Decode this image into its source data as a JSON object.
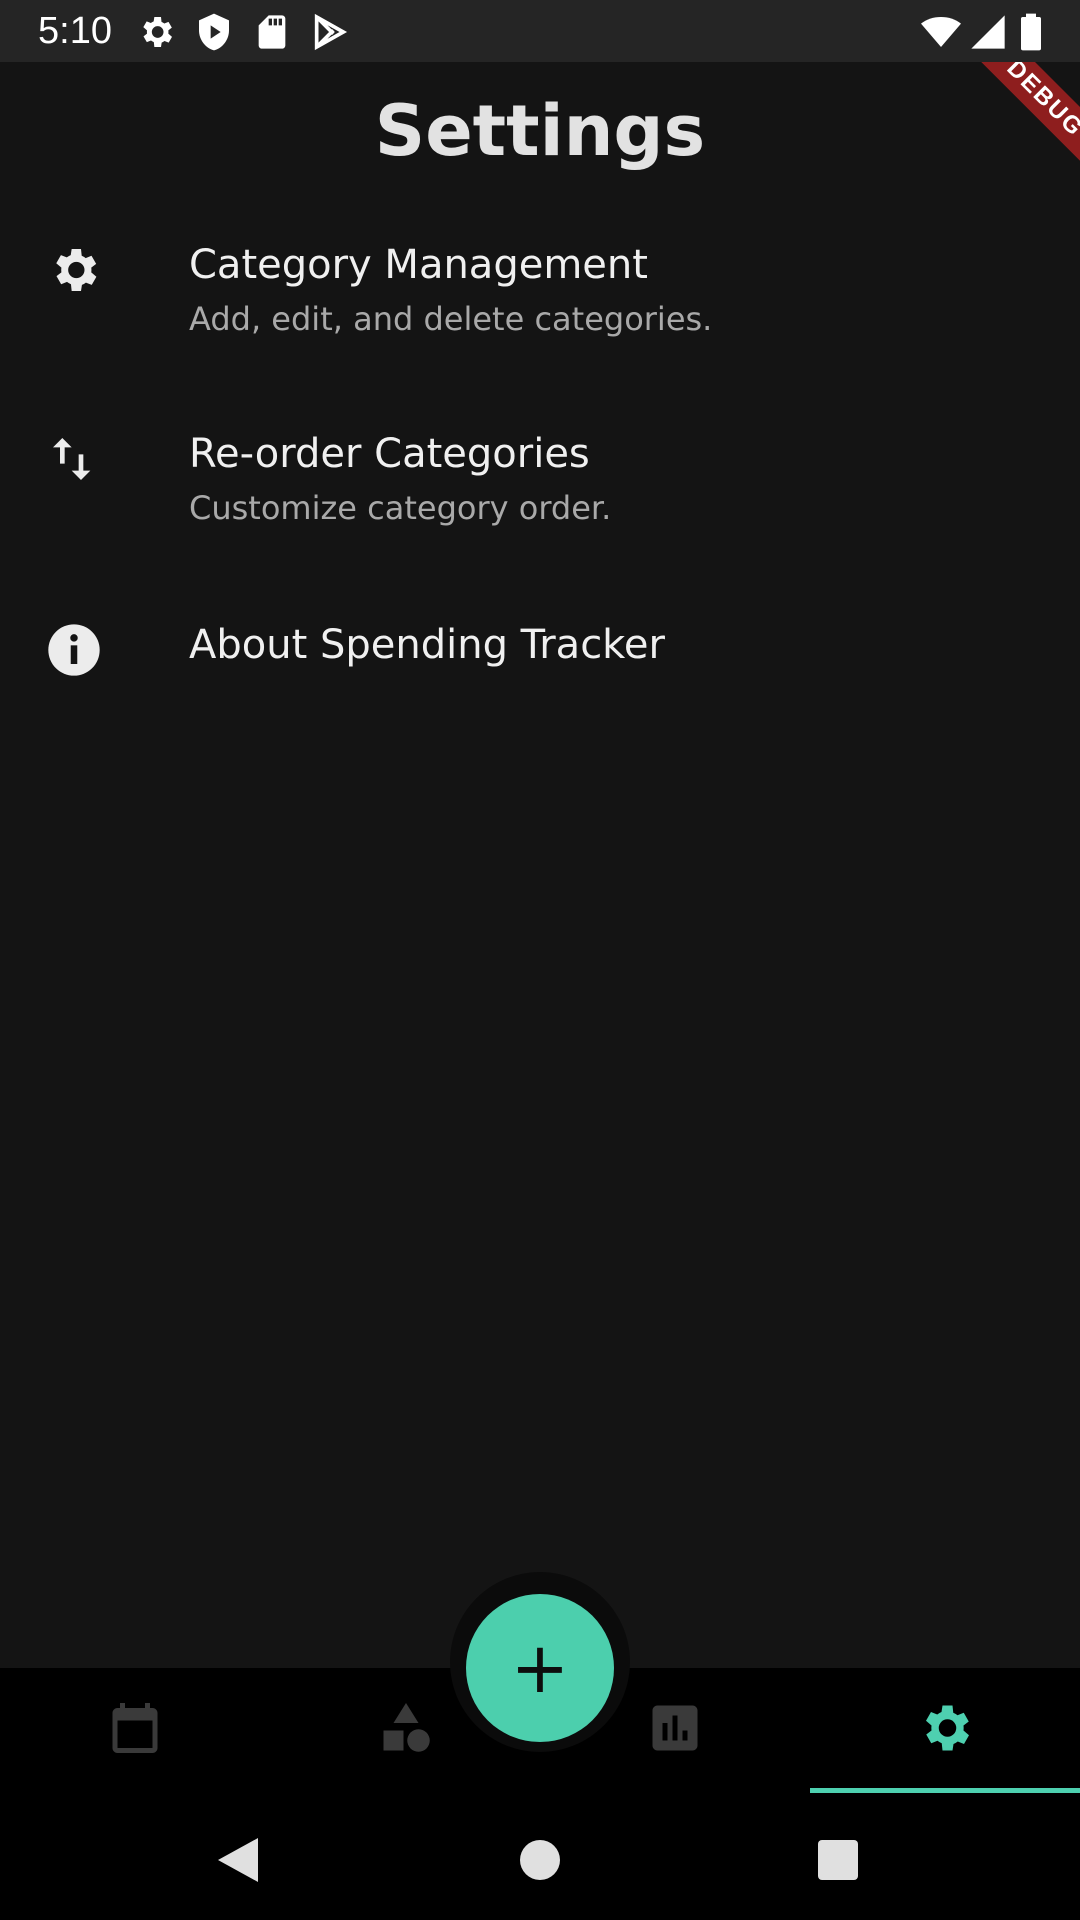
{
  "status_bar": {
    "time": "5:10",
    "icons": [
      "settings-icon",
      "shield-icon",
      "sd-card-icon",
      "play-store-icon",
      "wifi-icon",
      "signal-icon",
      "battery-icon"
    ]
  },
  "debug_banner": "DEBUG",
  "header": {
    "title": "Settings"
  },
  "settings": [
    {
      "icon": "gear-icon",
      "label": "Category Management",
      "subtitle": "Add, edit, and delete categories."
    },
    {
      "icon": "swap-vert-icon",
      "label": "Re-order Categories",
      "subtitle": "Customize category order."
    },
    {
      "icon": "info-icon",
      "label": "About Spending Tracker"
    }
  ],
  "fab": {
    "label": "+",
    "color": "#4ccfad"
  },
  "bottom_nav": {
    "items": [
      "calendar-icon",
      "shapes-icon",
      "bar-chart-icon",
      "gear-icon"
    ],
    "active": "gear-icon",
    "active_color": "#4ed0b0"
  },
  "system_nav": [
    "back-icon",
    "home-icon",
    "recents-icon"
  ]
}
